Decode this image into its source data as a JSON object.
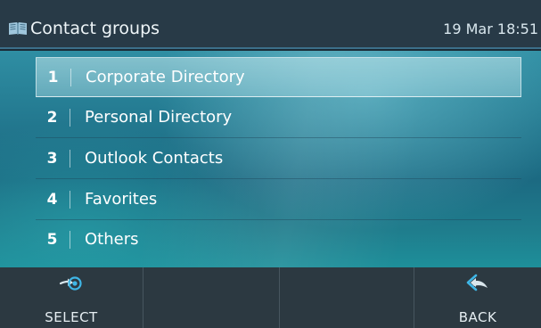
{
  "header": {
    "icon": "book-icon",
    "title": "Contact groups",
    "clock": "19 Mar 18:51"
  },
  "list": {
    "items": [
      {
        "number": "1",
        "label": "Corporate Directory",
        "selected": true
      },
      {
        "number": "2",
        "label": "Personal Directory",
        "selected": false
      },
      {
        "number": "3",
        "label": "Outlook Contacts",
        "selected": false
      },
      {
        "number": "4",
        "label": "Favorites",
        "selected": false
      },
      {
        "number": "5",
        "label": "Others",
        "selected": false
      }
    ]
  },
  "softkeys": {
    "select": {
      "label": "SELECT",
      "icon": "select-arrow-icon"
    },
    "empty1": {
      "label": ""
    },
    "empty2": {
      "label": ""
    },
    "back": {
      "label": "BACK",
      "icon": "back-arrow-icon"
    }
  },
  "colors": {
    "header_bg": "#283a47",
    "header_border": "#3c6f8a",
    "softkey_bg": "#2c3941",
    "accent": "#3fb6e6"
  }
}
